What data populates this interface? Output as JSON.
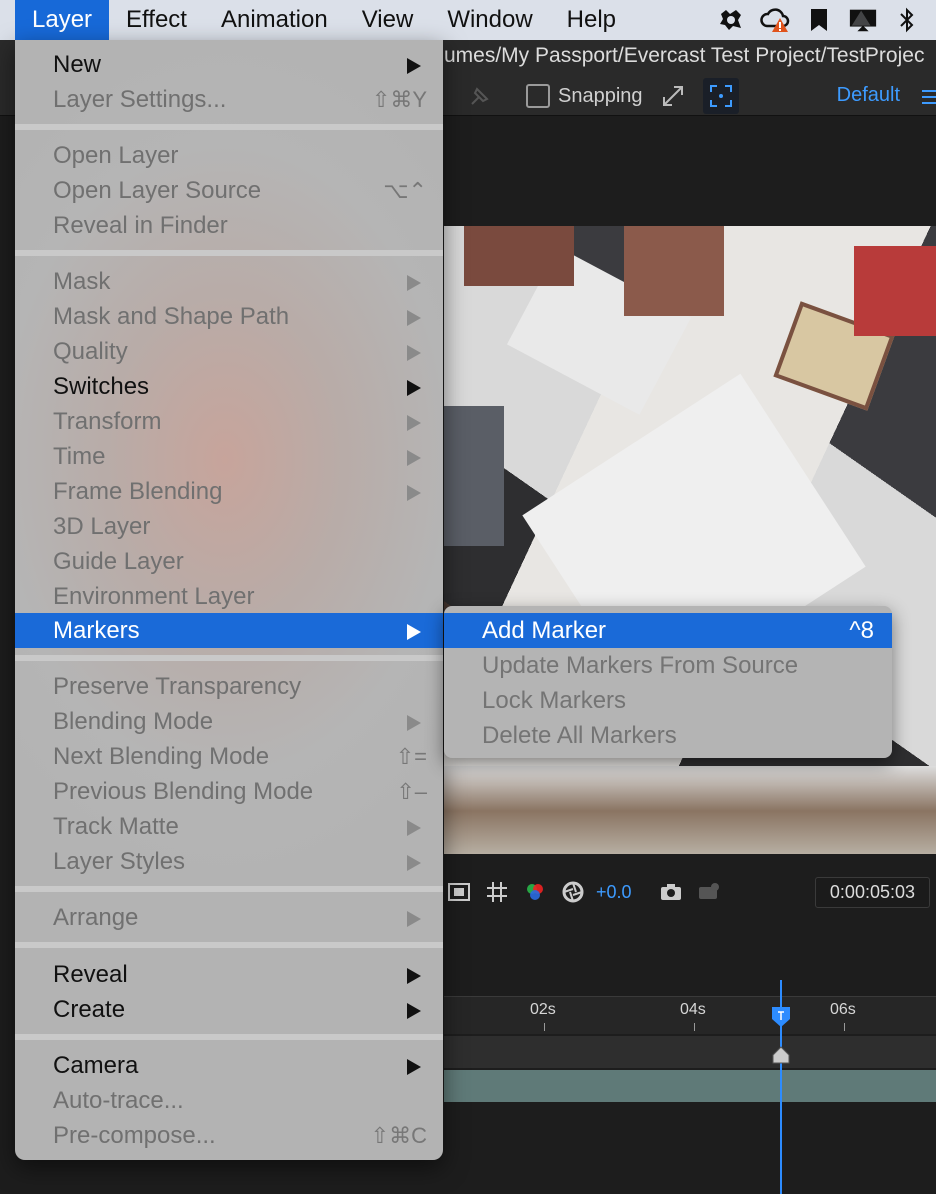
{
  "menubar": {
    "items": [
      {
        "label": "Layer",
        "active": true
      },
      {
        "label": "Effect",
        "active": false
      },
      {
        "label": "Animation",
        "active": false
      },
      {
        "label": "View",
        "active": false
      },
      {
        "label": "Window",
        "active": false
      },
      {
        "label": "Help",
        "active": false
      }
    ],
    "status_icons": [
      "app-status-icon",
      "creative-cloud-warning-icon",
      "bookmark-icon",
      "display-icon",
      "bluetooth-icon"
    ]
  },
  "app": {
    "path": "umes/My Passport/Evercast Test Project/TestProjec",
    "snapping_label": "Snapping",
    "workspace": "Default",
    "exposure": "+0.0",
    "timecode": "0:00:05:03",
    "ruler": [
      "02s",
      "04s",
      "06s"
    ],
    "accent": "#3d9bff"
  },
  "menu": {
    "highlight_color": "#1a6ad8",
    "items": [
      {
        "label": "New",
        "enabled": true,
        "submenu": true,
        "shortcut": ""
      },
      {
        "label": "Layer Settings...",
        "enabled": false,
        "submenu": false,
        "shortcut": "⇧⌘Y"
      },
      {
        "label": "Open Layer",
        "enabled": false,
        "submenu": false,
        "shortcut": ""
      },
      {
        "label": "Open Layer Source",
        "enabled": false,
        "submenu": false,
        "shortcut": "⌥⌃"
      },
      {
        "label": "Reveal in Finder",
        "enabled": false,
        "submenu": false,
        "shortcut": ""
      },
      {
        "label": "Mask",
        "enabled": false,
        "submenu": true,
        "shortcut": ""
      },
      {
        "label": "Mask and Shape Path",
        "enabled": false,
        "submenu": true,
        "shortcut": ""
      },
      {
        "label": "Quality",
        "enabled": false,
        "submenu": true,
        "shortcut": ""
      },
      {
        "label": "Switches",
        "enabled": true,
        "submenu": true,
        "shortcut": ""
      },
      {
        "label": "Transform",
        "enabled": false,
        "submenu": true,
        "shortcut": ""
      },
      {
        "label": "Time",
        "enabled": false,
        "submenu": true,
        "shortcut": ""
      },
      {
        "label": "Frame Blending",
        "enabled": false,
        "submenu": true,
        "shortcut": ""
      },
      {
        "label": "3D Layer",
        "enabled": false,
        "submenu": false,
        "shortcut": ""
      },
      {
        "label": "Guide Layer",
        "enabled": false,
        "submenu": false,
        "shortcut": ""
      },
      {
        "label": "Environment Layer",
        "enabled": false,
        "submenu": false,
        "shortcut": ""
      },
      {
        "label": "Markers",
        "enabled": true,
        "submenu": true,
        "shortcut": "",
        "highlighted": true
      },
      {
        "label": "Preserve Transparency",
        "enabled": false,
        "submenu": false,
        "shortcut": ""
      },
      {
        "label": "Blending Mode",
        "enabled": false,
        "submenu": true,
        "shortcut": ""
      },
      {
        "label": "Next Blending Mode",
        "enabled": false,
        "submenu": false,
        "shortcut": "⇧="
      },
      {
        "label": "Previous Blending Mode",
        "enabled": false,
        "submenu": false,
        "shortcut": "⇧–"
      },
      {
        "label": "Track Matte",
        "enabled": false,
        "submenu": true,
        "shortcut": ""
      },
      {
        "label": "Layer Styles",
        "enabled": false,
        "submenu": true,
        "shortcut": ""
      },
      {
        "label": "Arrange",
        "enabled": false,
        "submenu": true,
        "shortcut": ""
      },
      {
        "label": "Reveal",
        "enabled": true,
        "submenu": true,
        "shortcut": ""
      },
      {
        "label": "Create",
        "enabled": true,
        "submenu": true,
        "shortcut": ""
      },
      {
        "label": "Camera",
        "enabled": true,
        "submenu": true,
        "shortcut": ""
      },
      {
        "label": "Auto-trace...",
        "enabled": false,
        "submenu": false,
        "shortcut": ""
      },
      {
        "label": "Pre-compose...",
        "enabled": false,
        "submenu": false,
        "shortcut": "⇧⌘C"
      }
    ]
  },
  "submenu": {
    "items": [
      {
        "label": "Add Marker",
        "enabled": true,
        "shortcut": "^8",
        "highlighted": true
      },
      {
        "label": "Update Markers From Source",
        "enabled": false,
        "shortcut": ""
      },
      {
        "label": "Lock Markers",
        "enabled": false,
        "shortcut": ""
      },
      {
        "label": "Delete All Markers",
        "enabled": false,
        "shortcut": ""
      }
    ]
  }
}
